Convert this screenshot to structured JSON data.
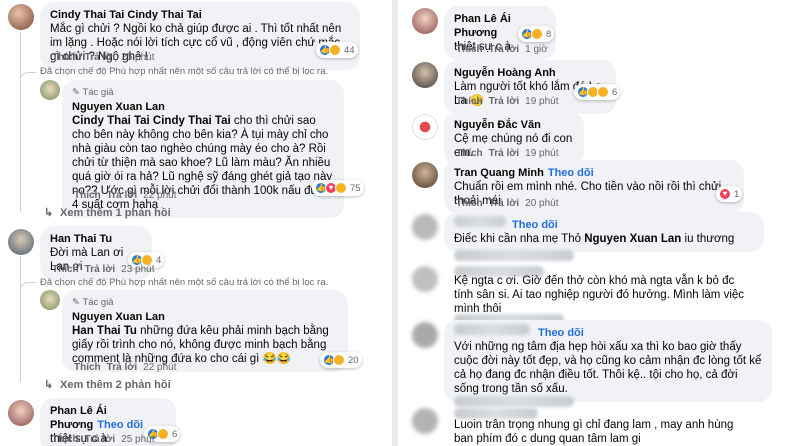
{
  "left": {
    "c1": {
      "name": "Cindy Thai Tai Cindy Thai Tai",
      "text": "Mắc gì chửi ? Ngồi ko chả giúp được ai . Thì tốt nhất nên im lặng . Hoặc nói lời tích cực cổ vũ , động viên chứ mắc gì chửi ? Ngộ ghê !",
      "like": "Thích",
      "reply": "Trả lời",
      "time": "25 phút",
      "count": "44"
    },
    "note1": "Đã chọn chế độ Phù hợp nhất nên một số câu trả lời có thể bị lọc ra.",
    "c2": {
      "tag": "Tác giả",
      "name": "Nguyen Xuan Lan",
      "mention": "Cindy Thai Tai Cindy Thai Tai",
      "text": " cho thì chửi sao cho bên này không cho bên kia? À tụi mày chỉ cho nhà giàu còn tao nghèo chúng mày éo cho à? Rồi chửi từ thiện mà sao khoe? Lũ làm màu? Ăn nhiều quá giờ ói ra hả? Lũ nghệ sỹ đáng ghét giả tạo này nọ?? Ước gì mỗi lời chửi đổi thành 100k nấu được 4 suất cơm haha",
      "like": "Thích",
      "reply": "Trả lời",
      "time": "22 phút",
      "count": "75"
    },
    "more1": "Xem thêm 1 phản hồi",
    "c3": {
      "name": "Han Thai Tu",
      "text": "Đời mà Lan ơi Lan ơi",
      "like": "Thích",
      "reply": "Trả lời",
      "time": "23 phút",
      "count": "4"
    },
    "note2": "Đã chọn chế độ Phù hợp nhất nên một số câu trả lời có thể bị lọc ra.",
    "c4": {
      "tag": "Tác giả",
      "name": "Nguyen Xuan Lan",
      "mention": "Han Thai Tu",
      "text": " những đứa kêu phải minh bạch bằng giấy rồi trình cho nó, không được minh bạch bằng comment là những đứa ko cho cái gì 😂😂",
      "like": "Thích",
      "reply": "Trả lời",
      "time": "22 phút",
      "count": "20"
    },
    "more2": "Xem thêm 2 phản hồi",
    "c5": {
      "name": "Phan Lê Ái Phương",
      "follow": "Theo dõi",
      "text": "thiệt sự c à",
      "like": "Thích",
      "reply": "Trả lời",
      "time": "25 phút",
      "count": "6"
    }
  },
  "right": {
    "c1": {
      "name": "Phan Lê Ái Phương",
      "text": "thiệt sự c à",
      "like": "Thích",
      "reply": "Trả lời",
      "time": "1 giờ",
      "count": "8"
    },
    "c2": {
      "name": "Nguyễn Hoàng Anh",
      "text": "Làm người tốt khó lắm đó La La 😞",
      "like": "Thích",
      "reply": "Trả lời",
      "time": "19 phút",
      "count": "6"
    },
    "c3": {
      "name": "Nguyễn Đắc Văn",
      "text": "Cệ mẹ chúng nó đi con em.",
      "like": "Thích",
      "reply": "Trả lời",
      "time": "19 phút"
    },
    "c4": {
      "name": "Tran Quang Minh",
      "follow": "Theo dõi",
      "text": "Chuẩn rồi em mình nhé. Cho tiền vào nồi rồi thì chửi thoải mái",
      "like": "Thích",
      "reply": "Trả lời",
      "time": "20 phút",
      "count": "1"
    },
    "c5": {
      "follow": "Theo dõi",
      "text": "Điếc khi cần nha mẹ Thỏ ",
      "mention": "Nguyen Xuan Lan",
      "text2": " iu thương"
    },
    "c6": {
      "text": "Kệ ngta c ơi. Giờ đến thở còn khó mà ngta vẫn k bỏ đc tính sân si. Ai tao nghiệp người đó hưởng. Mình làm việc mình thôi"
    },
    "c7": {
      "follow": "Theo dõi",
      "text": "Với những ng tâm địa hẹp hòi xấu xa thì ko bao giờ thấy cuộc đời này tốt đẹp, và họ cũng ko cảm nhận đc lòng tốt kể cả họ đang đc nhận điều tốt. Thôi kệ.. tội cho họ, cả đời sống trong tần số xấu."
    },
    "c8": {
      "text": "Luoin trân trọng nhung gì chỉ đang lam , may anh hùng ban phím đó c dung quan tâm lam gi"
    }
  }
}
